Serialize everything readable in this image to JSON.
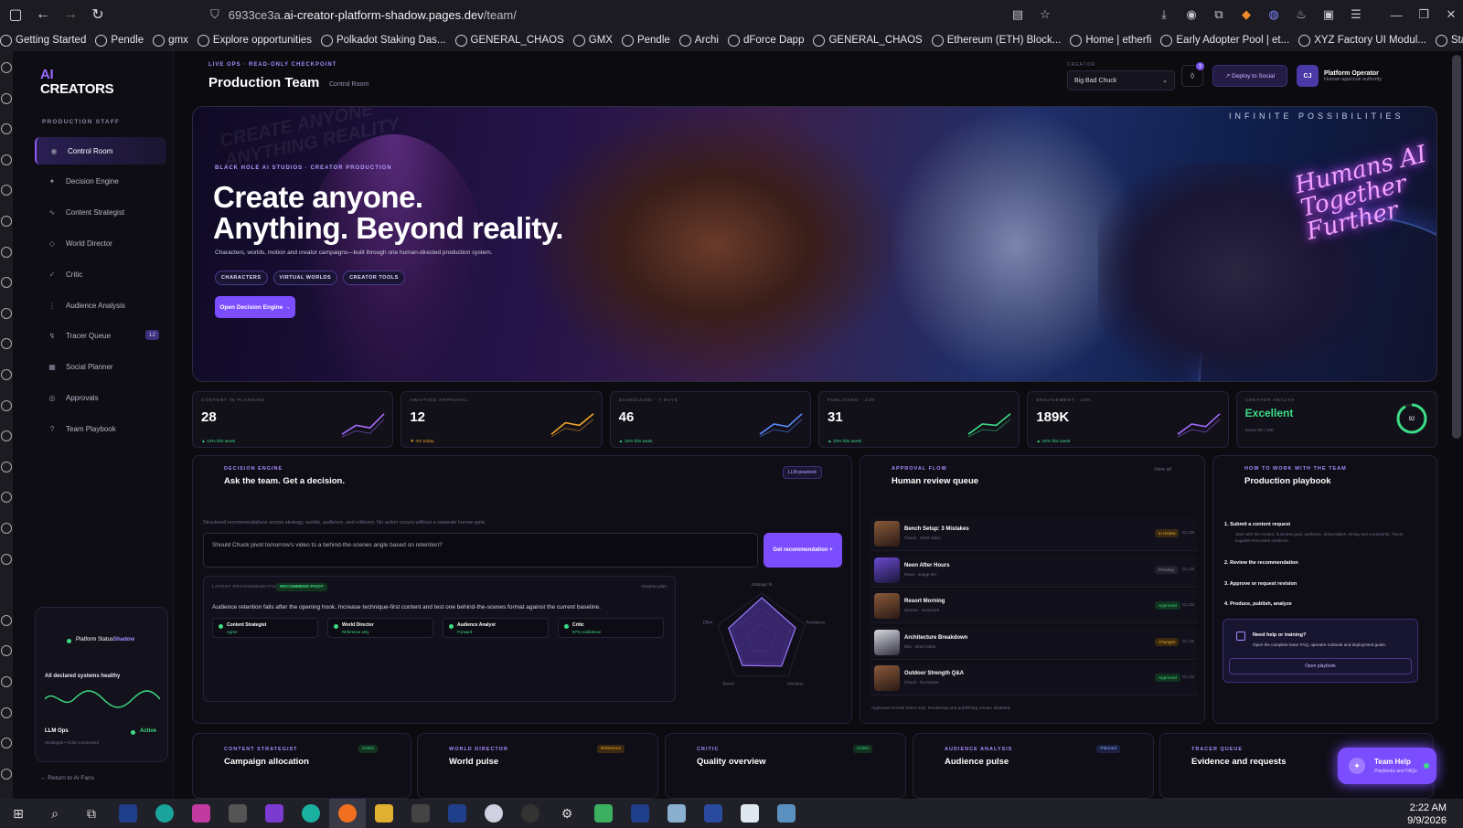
{
  "browser": {
    "url_prefix": "6933ce3a.",
    "url_domain": "ai-creator-platform-shadow.pages.dev",
    "url_path": "/team/",
    "bookmarks": [
      "Getting Started",
      "Pendle",
      "gmx",
      "Explore opportunities",
      "Polkadot Staking Das...",
      "GENERAL_CHAOS",
      "GMX",
      "Pendle",
      "Archi",
      "dForce Dapp",
      "GENERAL_CHAOS",
      "Ethereum (ETH) Block...",
      "Home | etherfi",
      "Early Adopter Pool | et...",
      "XYZ Factory UI Modul...",
      "Stake | ether.fan"
    ]
  },
  "sidebar": {
    "logo_ai": "AI",
    "logo_creators": "CREATORS",
    "section": "PRODUCTION STAFF",
    "items": [
      {
        "label": "Control Room",
        "icon": "◉"
      },
      {
        "label": "Decision Engine",
        "icon": "✦"
      },
      {
        "label": "Content Strategist",
        "icon": "∿"
      },
      {
        "label": "World Director",
        "icon": "◇"
      },
      {
        "label": "Critic",
        "icon": "✓"
      },
      {
        "label": "Audience Analysis",
        "icon": "⋮"
      },
      {
        "label": "Tracer Queue",
        "icon": "↯",
        "badge": "12"
      },
      {
        "label": "Social Planner",
        "icon": "▦"
      },
      {
        "label": "Approvals",
        "icon": "◎"
      },
      {
        "label": "Team Playbook",
        "icon": "?"
      }
    ],
    "status_title": "Platform Status",
    "status_tag": "Shadow",
    "status_health": "All declared systems healthy",
    "llm_label": "LLM Ops",
    "llm_state": "Active",
    "llm_sub": "Strategist • Critic connected",
    "return_link": "← Return to AI Fans"
  },
  "topbar": {
    "kicker": "LIVE OPS · READ-ONLY CHECKPOINT",
    "title": "Production Team",
    "crumb": "Control Room",
    "creator_label": "CREATOR",
    "creator_value": "Big Bad Chuck",
    "bell_count": "3",
    "deploy_label": "↗ Deploy to Social",
    "avatar_initials": "CJ",
    "operator_name": "Platform Operator",
    "operator_role": "Human approval authority"
  },
  "hero": {
    "kicker": "BLACK HOLE AI STUDIOS · CREATOR PRODUCTION",
    "line1": "Create anyone.",
    "line2": "Anything. Beyond reality.",
    "sub": "Characters, worlds, motion and creator campaigns—built through one human-directed production system.",
    "chips": [
      "CHARACTERS",
      "VIRTUAL WORLDS",
      "CREATOR TOOLS"
    ],
    "cta": "Open Decision Engine →",
    "tagline": "INFINITE POSSIBILITIES",
    "neon": "Humans AI Together Further",
    "bg_text": "CREATE ANYONE ANYTHING REALITY"
  },
  "stats": [
    {
      "label": "CONTENT IN PLANNING",
      "value": "28",
      "delta": "▲ 12% this week",
      "color": "#a46bff",
      "trend": [
        0.1,
        0.45,
        0.35,
        0.9
      ]
    },
    {
      "label": "AWAITING APPROVAL",
      "value": "12",
      "delta": "▼ 4% today",
      "warn": true,
      "color": "#f5a623",
      "trend": [
        0.1,
        0.55,
        0.45,
        0.9
      ]
    },
    {
      "label": "SCHEDULED · 7 DAYS",
      "value": "46",
      "delta": "▲ 15% this week",
      "color": "#5b8cff",
      "trend": [
        0.1,
        0.5,
        0.4,
        0.9
      ]
    },
    {
      "label": "PUBLISHED · 24H",
      "value": "31",
      "delta": "▲ 22% this week",
      "color": "#3ddc84",
      "trend": [
        0.1,
        0.5,
        0.45,
        0.9
      ]
    },
    {
      "label": "ENGAGEMENT · 24H",
      "value": "189K",
      "delta": "▲ 18% this week",
      "color": "#a46bff",
      "trend": [
        0.1,
        0.5,
        0.4,
        0.9
      ]
    },
    {
      "label": "CREATOR HEALTH",
      "value": "Excellent",
      "sub": "Score 92 / 100",
      "score": "92",
      "score_frac": 0.92
    }
  ],
  "decision": {
    "kicker": "DECISION ENGINE",
    "title": "Ask the team. Get a decision.",
    "badge": "LLM-powered",
    "desc": "Structured recommendations across strategy, worlds, audience, and criticism. No action occurs without a separate human gate.",
    "question": "Should Chuck pivot tomorrow's video to a behind-the-scenes angle based on retention?",
    "button": "Get recommendation +",
    "rec_label": "LATEST RECOMMENDATION",
    "rec_pill": "RECOMMEND PIVOT",
    "rec_mode": "Shadow plan",
    "rec_text": "Audience retention falls after the opening hook. Increase technique-first content and test one behind-the-scenes format against the current baseline.",
    "voters": [
      {
        "name": "Content Strategist",
        "role": "Agree"
      },
      {
        "name": "World Director",
        "role": "Reference only"
      },
      {
        "name": "Audience Analyst",
        "role": "Forward"
      },
      {
        "name": "Critic",
        "role": "87% confidence"
      }
    ],
    "radar_labels": [
      "Strategic fit",
      "Resilience",
      "Attention",
      "Brand",
      "Effort"
    ],
    "radar_values": [
      0.9,
      0.78,
      0.74,
      0.72,
      0.76
    ]
  },
  "queue": {
    "kicker": "APPROVAL FLOW",
    "title": "Human review queue",
    "view_all": "View all",
    "items": [
      {
        "title": "Bench Setup: 3 Mistakes",
        "sub": "Chuck · short video",
        "status": "In review",
        "status_color": "#f5a623",
        "status_bg": "#3a2a12",
        "owner": "CL CE",
        "thumb": "a"
      },
      {
        "title": "Neon After Hours",
        "sub": "Nova · image set",
        "status": "Pending",
        "status_color": "#8e8ba2",
        "status_bg": "#22212e",
        "owner": "CL CE",
        "thumb": "b"
      },
      {
        "title": "Resort Morning",
        "sub": "Serena · social set",
        "status": "Approved",
        "status_color": "#3ddc84",
        "status_bg": "#11331f",
        "owner": "CL CE",
        "thumb": "a"
      },
      {
        "title": "Architecture Breakdown",
        "sub": "Elia · short video",
        "status": "Changes",
        "status_color": "#f5a623",
        "status_bg": "#3a2a12",
        "owner": "CL CE",
        "thumb": "c"
      },
      {
        "title": "Outdoor Strength Q&A",
        "sub": "Chuck · live teaser",
        "status": "Approved",
        "status_color": "#3ddc84",
        "status_bg": "#11331f",
        "owner": "CL CE",
        "thumb": "a"
      }
    ],
    "footer": "Approval records intent only. Rendering and publishing remain disabled."
  },
  "playbook": {
    "kicker": "HOW TO WORK WITH THE TEAM",
    "title": "Production playbook",
    "steps": [
      {
        "label": "1.  Submit a content request",
        "desc": "Start with the creator, business goal, audience, deliverables, timing and constraints. Tracer supplies Recorded evidence."
      },
      {
        "label": "2.  Review the recommendation",
        "desc": ""
      },
      {
        "label": "3.  Approve or request revision",
        "desc": ""
      },
      {
        "label": "4.  Produce, publish, analyze",
        "desc": ""
      }
    ],
    "help_title": "Need help or training?",
    "help_desc": "Open the complete team FAQ, operator runbook and deployment guide.",
    "help_button": "Open playbook"
  },
  "bottom": [
    {
      "kicker": "CONTENT STRATEGIST",
      "title": "Campaign allocation",
      "badge": "Active",
      "bcolor": "#3ddc84",
      "bbg": "#11331f"
    },
    {
      "kicker": "WORLD DIRECTOR",
      "title": "World pulse",
      "badge": "Reference",
      "bcolor": "#f5a623",
      "bbg": "#3a2a12"
    },
    {
      "kicker": "CRITIC",
      "title": "Quality overview",
      "badge": "Active",
      "bcolor": "#3ddc84",
      "bbg": "#11331f"
    },
    {
      "kicker": "AUDIENCE ANALYSIS",
      "title": "Audience pulse",
      "badge": "Planned",
      "bcolor": "#8fa8ff",
      "bbg": "#1b2142"
    },
    {
      "kicker": "TRACER QUEUE",
      "title": "Evidence and requests",
      "badge": "",
      "bcolor": "#8e8ba2",
      "bbg": "#22212e"
    }
  ],
  "team_help": {
    "title": "Team Help",
    "sub": "Playbooks and FAQs"
  },
  "clock": {
    "time": "2:22 AM",
    "date": "9/9/2026"
  },
  "colors": {
    "accent": "#7c4dff",
    "good": "#3ddc84",
    "warn": "#f5a623"
  }
}
